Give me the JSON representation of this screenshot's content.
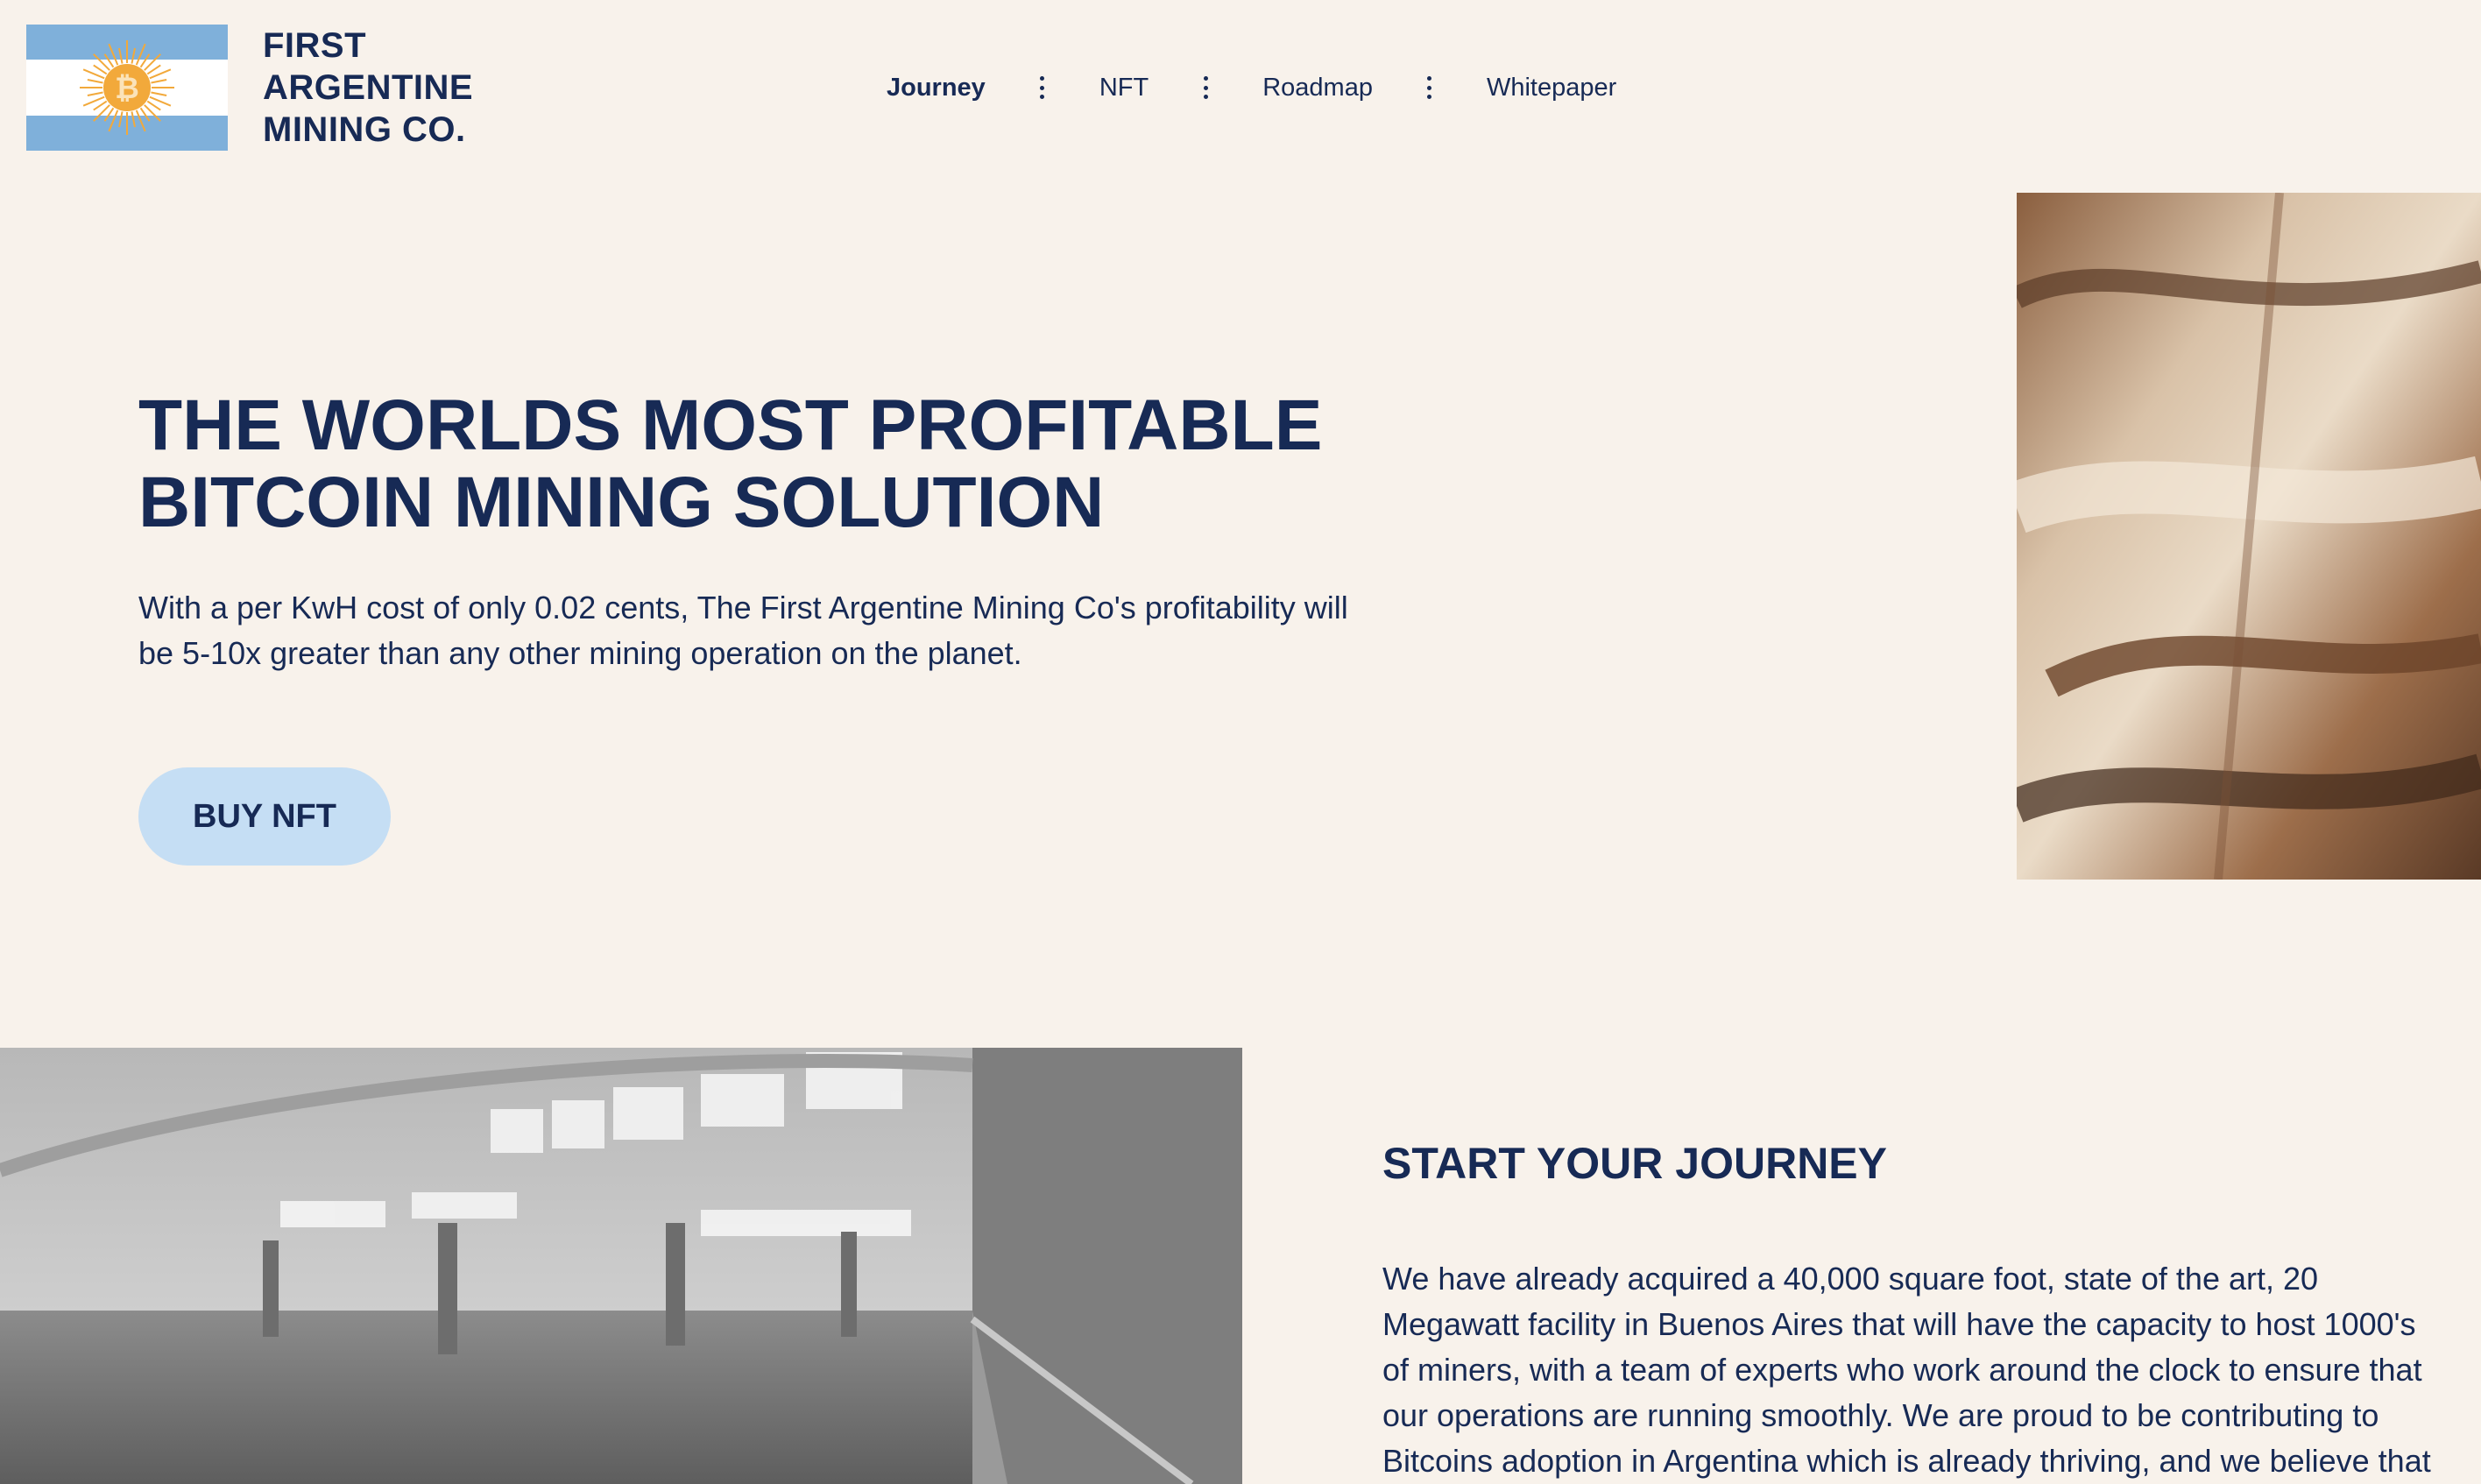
{
  "brand": {
    "name_lines": [
      "FIRST",
      "ARGENTINE",
      "MINING CO."
    ],
    "logo_icon": "argentina-flag-bitcoin-sun-icon",
    "colors": {
      "flag_blue": "#7fb0da",
      "sun": "#f2a93b",
      "navy": "#172a55",
      "background": "#f8f2eb"
    }
  },
  "nav": {
    "items": [
      {
        "label": "Journey",
        "active": true
      },
      {
        "label": "NFT",
        "active": false
      },
      {
        "label": "Roadmap",
        "active": false
      },
      {
        "label": "Whitepaper",
        "active": false
      }
    ],
    "separator_icon": "vertical-dots-icon"
  },
  "hero": {
    "title_lines": [
      "THE WORLDS MOST PROFITABLE",
      "BITCOIN MINING SOLUTION"
    ],
    "description": "With a per KwH cost of only 0.02 cents, The First Argentine Mining Co's profitability will be 5-10x greater than any other mining operation on the planet.",
    "cta_label": "BUY NFT",
    "cta_color": "#c5def4",
    "image": "aerial-desert-terrain-image"
  },
  "journey": {
    "title": "START YOUR JOURNEY",
    "body": "We have already acquired a 40,000 square foot, state of the art, 20 Megawatt facility in Buenos Aires that will have the capacity to host 1000's of miners, with a team of experts who work around the clock to ensure that our operations are running smoothly. We are proud to be contributing to Bitcoins adoption in Argentina which is already thriving, and we believe that",
    "image": "warehouse-interior-image"
  }
}
